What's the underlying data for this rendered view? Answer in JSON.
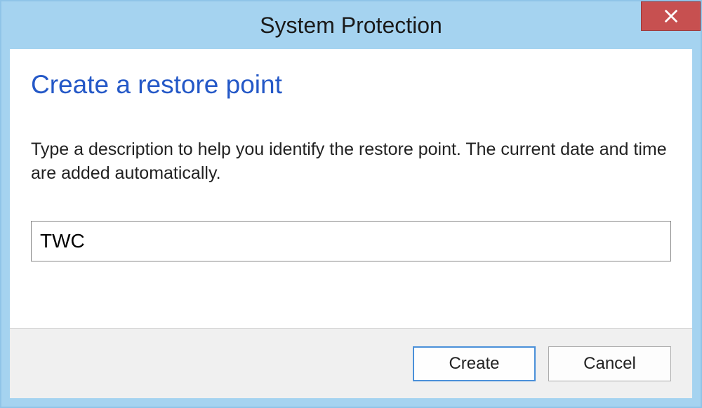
{
  "titlebar": {
    "title": "System Protection"
  },
  "main": {
    "heading": "Create a restore point",
    "description": "Type a description to help you identify the restore point. The current date and time are added automatically.",
    "input_value": "TWC"
  },
  "buttons": {
    "create_label": "Create",
    "cancel_label": "Cancel"
  }
}
